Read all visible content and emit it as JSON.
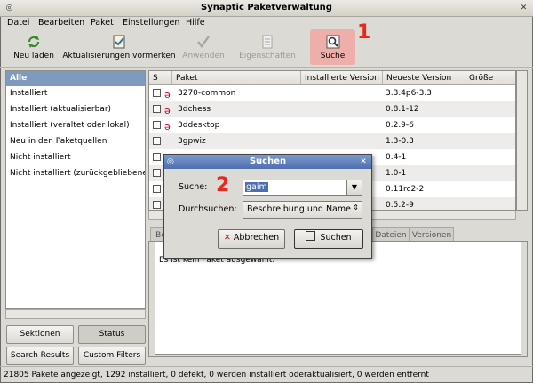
{
  "window": {
    "title": "Synaptic Paketverwaltung"
  },
  "menu": [
    "Datei",
    "Bearbeiten",
    "Paket",
    "Einstellungen",
    "Hilfe"
  ],
  "toolbar": {
    "reload": "Neu laden",
    "mark_upgrades": "Aktualisierungen vormerken",
    "apply": "Anwenden",
    "properties": "Eigenschaften",
    "search": "Suche"
  },
  "annotations": {
    "one": "1",
    "two": "2"
  },
  "filters": {
    "items": [
      "Alle",
      "Installiert",
      "Installiert (aktualisierbar)",
      "Installiert (veraltet oder lokal)",
      "Neu in den Paketquellen",
      "Nicht installiert",
      "Nicht installiert (zurückgebliebene"
    ],
    "buttons": {
      "sections": "Sektionen",
      "status": "Status",
      "search_results": "Search Results",
      "custom_filters": "Custom Filters"
    }
  },
  "package_list": {
    "columns": [
      "S",
      "Paket",
      "Installierte Version",
      "Neueste Version",
      "Größe"
    ],
    "rows": [
      {
        "name": "3270-common",
        "latest": "3.3.4p6-3.3"
      },
      {
        "name": "3dchess",
        "latest": "0.8.1-12"
      },
      {
        "name": "3ddesktop",
        "latest": "0.2.9-6"
      },
      {
        "name": "3gpwiz",
        "latest": "1.3-0.3"
      },
      {
        "name": "",
        "latest": "0.4-1"
      },
      {
        "name": "",
        "latest": "1.0-1"
      },
      {
        "name": "",
        "latest": "0.11rc2-2"
      },
      {
        "name": "",
        "latest": "0.5.2-9"
      }
    ]
  },
  "detail": {
    "tabs": {
      "first": "Be",
      "files": "Dateien",
      "versions": "Versionen"
    },
    "message": "Es ist kein Paket ausgewählt."
  },
  "dialog": {
    "title": "Suchen",
    "search_label": "Suche:",
    "search_value": "gaim",
    "scope_label": "Durchsuchen:",
    "scope_value": "Beschreibung und Name",
    "cancel": "Abbrechen",
    "search": "Suchen"
  },
  "statusbar": "21805 Pakete angezeigt, 1292 installiert, 0 defekt, 0 werden installiert oderaktualisiert, 0 werden entfernt",
  "colors": {
    "highlight": "#f1a7a2",
    "annotation": "#e8281e",
    "selection": "#7e9bbf"
  }
}
